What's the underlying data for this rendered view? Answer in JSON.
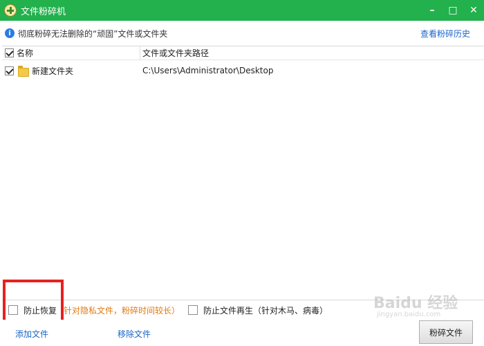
{
  "window": {
    "title": "文件粉碎机",
    "controls": {
      "minimize": "–",
      "maximize": "□",
      "close": "✕"
    }
  },
  "info": {
    "text": "彻底粉碎无法删除的“顽固”文件或文件夹",
    "history_link": "查看粉碎历史"
  },
  "table": {
    "columns": {
      "name": "名称",
      "path": "文件或文件夹路径"
    },
    "rows": [
      {
        "name": "新建文件夹",
        "path": "C:\\Users\\Administrator\\Desktop",
        "checked": true
      }
    ]
  },
  "options": {
    "prevent_recovery": "防止恢复",
    "prevent_recovery_note": "针对隐私文件，粉碎时间较长）",
    "prevent_regen": "防止文件再生（针对木马、病毒）"
  },
  "bottom": {
    "add_file": "添加文件",
    "remove_file": "移除文件",
    "shred_button": "粉碎文件"
  },
  "watermark": {
    "main": "Baidu 经验",
    "sub": "jingyan.baidu.com"
  },
  "colors": {
    "titlebar": "#22b14c",
    "link": "#1a64c8",
    "note": "#e07a10",
    "highlight": "#e8201f"
  }
}
